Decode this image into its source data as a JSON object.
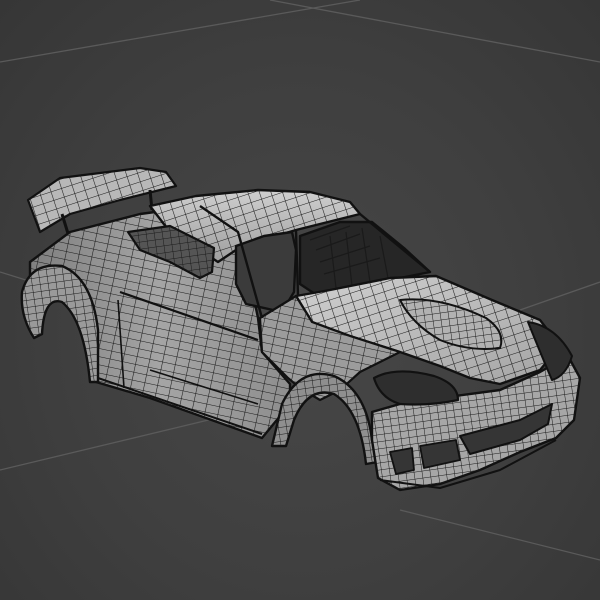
{
  "scene": {
    "subject": "car-body-wireframe",
    "colors": {
      "background": "#3d3d3d",
      "grid_line": "#5a5a5a",
      "surface_light": "#c4c4c4",
      "surface_mid": "#a9a9a9",
      "surface_dark": "#8a8a8a",
      "interior": "#2a2a2a",
      "wire": "#111111"
    }
  }
}
